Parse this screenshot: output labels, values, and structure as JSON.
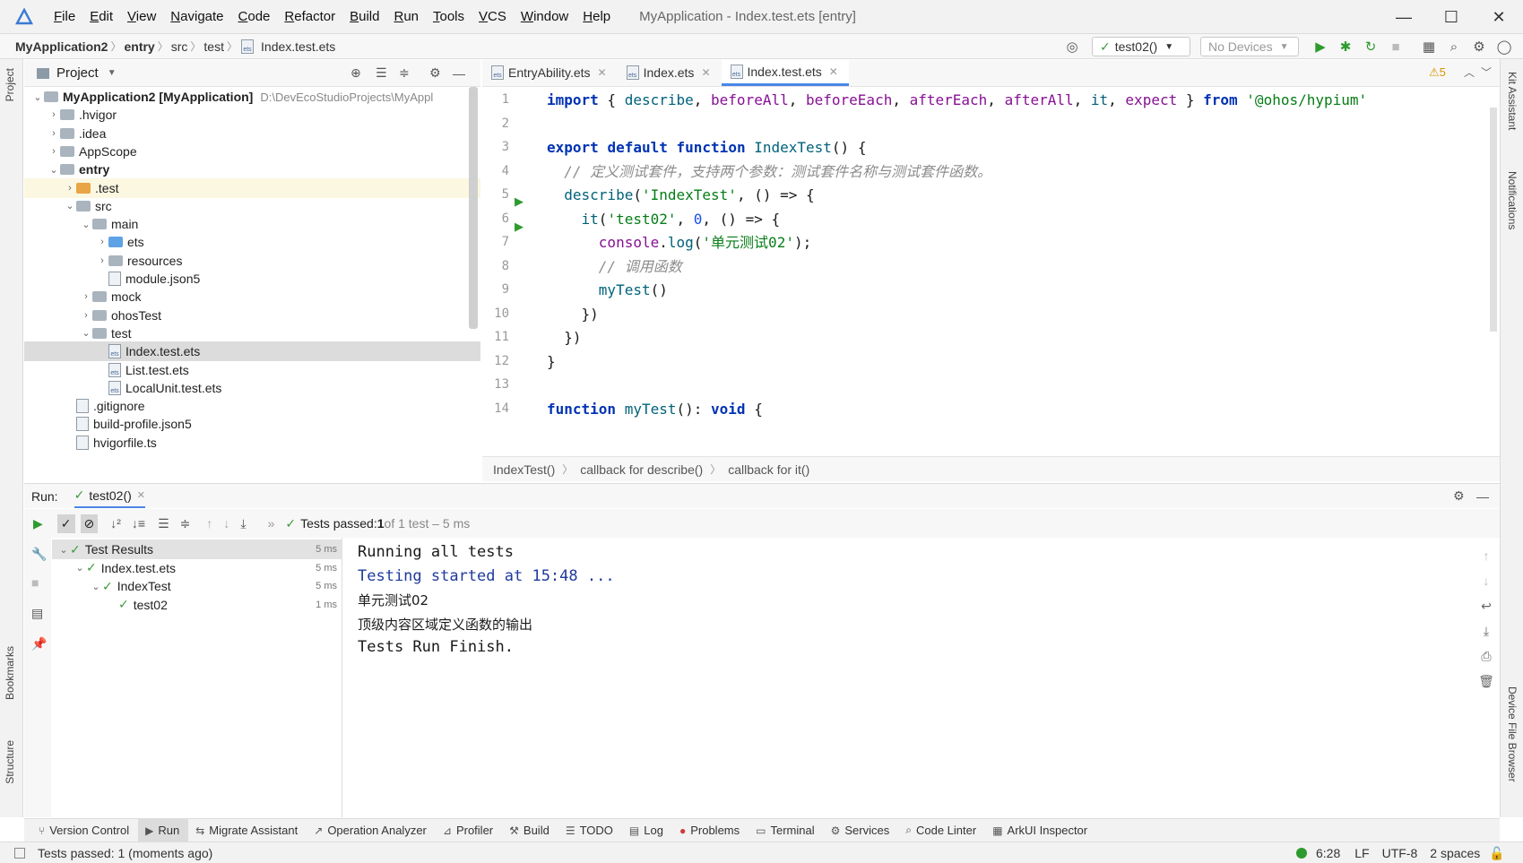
{
  "window": {
    "menu": [
      "File",
      "Edit",
      "View",
      "Navigate",
      "Code",
      "Refactor",
      "Build",
      "Run",
      "Tools",
      "VCS",
      "Window",
      "Help"
    ],
    "title": "MyApplication - Index.test.ets [entry]",
    "controls": {
      "minimize": "—",
      "maximize": "☐",
      "close": "✕"
    }
  },
  "breadcrumb": [
    "MyApplication2",
    "entry",
    "src",
    "test",
    "Index.test.ets"
  ],
  "toolbar": {
    "run_config": "test02()",
    "device": "No Devices"
  },
  "left_strip": {
    "project": "Project",
    "bookmarks": "Bookmarks",
    "structure": "Structure"
  },
  "right_strip": {
    "kit": "Kit Assistant",
    "notifications": "Notifications",
    "device_file": "Device File Browser"
  },
  "project_panel": {
    "title": "Project",
    "tree": [
      {
        "label": "MyApplication2 [MyApplication]",
        "extra": "D:\\DevEcoStudioProjects\\MyAppl",
        "depth": 0,
        "type": "root",
        "open": true
      },
      {
        "label": ".hvigor",
        "depth": 1,
        "type": "folder",
        "open": false
      },
      {
        "label": ".idea",
        "depth": 1,
        "type": "folder",
        "open": false
      },
      {
        "label": "AppScope",
        "depth": 1,
        "type": "folder",
        "open": false
      },
      {
        "label": "entry",
        "depth": 1,
        "type": "module",
        "open": true
      },
      {
        "label": ".test",
        "depth": 2,
        "type": "orange",
        "open": false
      },
      {
        "label": "src",
        "depth": 2,
        "type": "folder",
        "open": true
      },
      {
        "label": "main",
        "depth": 3,
        "type": "folder",
        "open": true
      },
      {
        "label": "ets",
        "depth": 4,
        "type": "blue",
        "open": false
      },
      {
        "label": "resources",
        "depth": 4,
        "type": "folder",
        "open": false
      },
      {
        "label": "module.json5",
        "depth": 4,
        "type": "file"
      },
      {
        "label": "mock",
        "depth": 3,
        "type": "folder",
        "open": false
      },
      {
        "label": "ohosTest",
        "depth": 3,
        "type": "folder",
        "open": false
      },
      {
        "label": "test",
        "depth": 3,
        "type": "folder",
        "open": true
      },
      {
        "label": "Index.test.ets",
        "depth": 4,
        "type": "ets"
      },
      {
        "label": "List.test.ets",
        "depth": 4,
        "type": "ets"
      },
      {
        "label": "LocalUnit.test.ets",
        "depth": 4,
        "type": "ets"
      },
      {
        "label": ".gitignore",
        "depth": 2,
        "type": "file"
      },
      {
        "label": "build-profile.json5",
        "depth": 2,
        "type": "file"
      },
      {
        "label": "hvigorfile.ts",
        "depth": 2,
        "type": "file"
      }
    ]
  },
  "editor": {
    "tabs": [
      {
        "label": "EntryAbility.ets",
        "active": false
      },
      {
        "label": "Index.ets",
        "active": false
      },
      {
        "label": "Index.test.ets",
        "active": true
      }
    ],
    "warnings": "⚠5",
    "line_numbers": [
      "1",
      "2",
      "3",
      "4",
      "5",
      "6",
      "7",
      "8",
      "9",
      "10",
      "11",
      "12",
      "13",
      "14"
    ],
    "lines": [
      "import { describe, beforeAll, beforeEach, afterEach, afterAll, it, expect } from '@ohos/hypium'",
      "",
      "export default function IndexTest() {",
      "  // 定义测试套件，支持两个参数：测试套件名称与测试套件函数。",
      "  describe('IndexTest', () => {",
      "    it('test02', 0, () => {",
      "      console.log('单元测试02');",
      "      // 调用函数",
      "      myTest()",
      "    })",
      "  })",
      "}",
      "",
      "function myTest(): void {"
    ],
    "breadcrumb": [
      "IndexTest()",
      "callback for describe()",
      "callback for it()"
    ]
  },
  "run_panel": {
    "label": "Run:",
    "tab": "test02()",
    "status_prefix": "Tests passed: ",
    "status_count": "1",
    "status_suffix": " of 1 test – 5 ms",
    "tests": [
      {
        "label": "Test Results",
        "ms": "5 ms",
        "depth": 0
      },
      {
        "label": "Index.test.ets",
        "ms": "5 ms",
        "depth": 1
      },
      {
        "label": "IndexTest",
        "ms": "5 ms",
        "depth": 2
      },
      {
        "label": "test02",
        "ms": "1 ms",
        "depth": 3
      }
    ],
    "console": [
      "Running all tests",
      "Testing started at 15:48 ...",
      "单元测试02",
      "顶级内容区域定义函数的输出",
      "Tests Run Finish."
    ]
  },
  "tool_tabs": [
    {
      "label": "Version Control",
      "icon": "branch-icon",
      "active": false
    },
    {
      "label": "Run",
      "icon": "play-icon",
      "active": true
    },
    {
      "label": "Migrate Assistant",
      "icon": "migrate-icon",
      "active": false
    },
    {
      "label": "Operation Analyzer",
      "icon": "chart-icon",
      "active": false
    },
    {
      "label": "Profiler",
      "icon": "profiler-icon",
      "active": false
    },
    {
      "label": "Build",
      "icon": "hammer-icon",
      "active": false
    },
    {
      "label": "TODO",
      "icon": "list-icon",
      "active": false
    },
    {
      "label": "Log",
      "icon": "log-icon",
      "active": false
    },
    {
      "label": "Problems",
      "icon": "error-icon",
      "active": false
    },
    {
      "label": "Terminal",
      "icon": "terminal-icon",
      "active": false
    },
    {
      "label": "Services",
      "icon": "services-icon",
      "active": false
    },
    {
      "label": "Code Linter",
      "icon": "linter-icon",
      "active": false
    },
    {
      "label": "ArkUI Inspector",
      "icon": "inspector-icon",
      "active": false
    }
  ],
  "statusbar": {
    "message": "Tests passed: 1 (moments ago)",
    "position": "6:28",
    "line_sep": "LF",
    "encoding": "UTF-8",
    "indent": "2 spaces"
  },
  "colors": {
    "accent": "#4a86e8",
    "pass": "#3c9a3c",
    "run": "#2e9b2e"
  }
}
